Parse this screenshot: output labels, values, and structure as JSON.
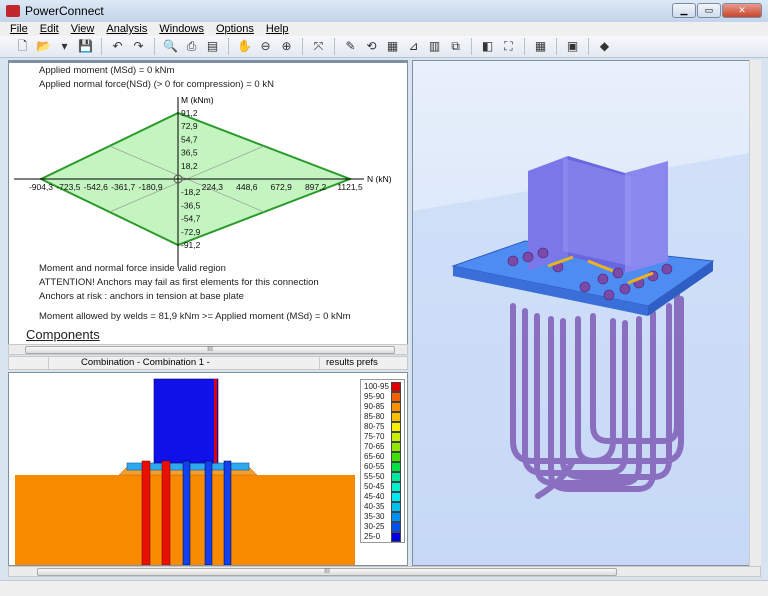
{
  "window": {
    "title": "PowerConnect",
    "controls": [
      "minimize",
      "maximize",
      "close"
    ]
  },
  "menu": [
    "File",
    "Edit",
    "View",
    "Analysis",
    "Windows",
    "Options",
    "Help"
  ],
  "toolbar": [
    "new-icon",
    "open-icon",
    "dropdown-icon",
    "save-icon",
    "|",
    "undo-icon",
    "redo-icon",
    "|",
    "print-preview-icon",
    "print-icon",
    "report-icon",
    "|",
    "pan-hand-icon",
    "zoom-out-icon",
    "zoom-in-icon",
    "|",
    "zoom-extents-icon",
    "|",
    "pencil-icon",
    "rotate-icon",
    "section-icon",
    "axes-icon",
    "color-scale-icon",
    "copy-icon",
    "|",
    "layers-icon",
    "fit-frame-icon",
    "|",
    "calculator-icon",
    "|",
    "monitor-icon",
    "|",
    "book-icon"
  ],
  "results": {
    "applied_moment": "Applied moment (MSd) = 0 kNm",
    "applied_normal": "Applied normal force(NSd) (> 0 for compression) = 0 kN",
    "msg1": "Moment and normal force inside valid region",
    "msg2": "ATTENTION! Anchors may fail as first elements for this connection",
    "msg3": "Anchors at risk : anchors in tension at base plate",
    "msg4": "Moment allowed by welds = 81,9 kNm >= Applied moment (MSd) = 0 kNm",
    "components_heading": "Components"
  },
  "chart_data": {
    "type": "area",
    "xlabel": "N (kN)",
    "ylabel": "M (kNm)",
    "x_ticks": [
      "-904,3",
      "-723,5",
      "-542,6",
      "-361,7",
      "-180,9",
      "224,3",
      "448,6",
      "672,9",
      "897,2",
      "1121,5"
    ],
    "x_tick_values": [
      -904.3,
      -723.5,
      -542.6,
      -361.7,
      -180.9,
      224.3,
      448.6,
      672.9,
      897.2,
      1121.5
    ],
    "y_ticks": [
      "91,2",
      "72,9",
      "54,7",
      "36,5",
      "18,2",
      "-18,2",
      "-36,5",
      "-54,7",
      "-72,9",
      "-91,2"
    ],
    "y_tick_values": [
      91.2,
      72.9,
      54.7,
      36.5,
      18.2,
      -18.2,
      -36.5,
      -54.7,
      -72.9,
      -91.2
    ],
    "polygon": [
      [
        -904.3,
        0
      ],
      [
        0,
        91.2
      ],
      [
        1121.5,
        0
      ],
      [
        0,
        -91.2
      ]
    ],
    "applied_point": [
      0,
      0
    ],
    "fill": "#c4f5c0",
    "stroke": "#2a9a2a"
  },
  "status1": {
    "combination": "Combination - Combination 1 -",
    "prefs": "results prefs"
  },
  "legend": {
    "labels": [
      "100-95",
      "95-90",
      "90-85",
      "85-80",
      "80-75",
      "75-70",
      "70-65",
      "65-60",
      "60-55",
      "55-50",
      "50-45",
      "45-40",
      "40-35",
      "35-30",
      "30-25",
      "25-0"
    ],
    "colors": [
      "#e00000",
      "#f06000",
      "#f89000",
      "#f8c000",
      "#f8f000",
      "#c8f000",
      "#90e800",
      "#40e000",
      "#00e040",
      "#00e8a0",
      "#00f0d0",
      "#00e8f0",
      "#00c0f0",
      "#0090f0",
      "#0050f0",
      "#0000e0"
    ]
  }
}
